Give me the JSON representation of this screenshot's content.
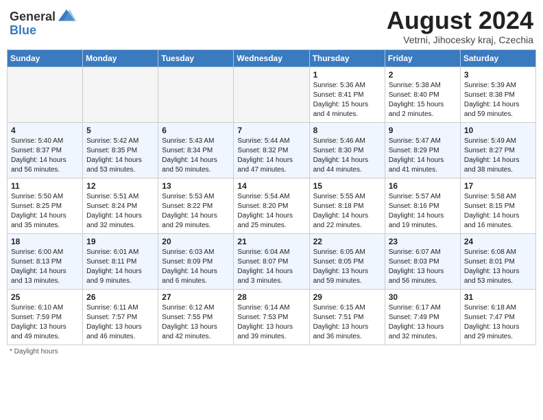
{
  "header": {
    "logo_general": "General",
    "logo_blue": "Blue",
    "month_year": "August 2024",
    "location": "Vetrni, Jihocesky kraj, Czechia"
  },
  "columns": [
    "Sunday",
    "Monday",
    "Tuesday",
    "Wednesday",
    "Thursday",
    "Friday",
    "Saturday"
  ],
  "weeks": [
    {
      "days": [
        {
          "num": "",
          "info": ""
        },
        {
          "num": "",
          "info": ""
        },
        {
          "num": "",
          "info": ""
        },
        {
          "num": "",
          "info": ""
        },
        {
          "num": "1",
          "info": "Sunrise: 5:36 AM\nSunset: 8:41 PM\nDaylight: 15 hours\nand 4 minutes."
        },
        {
          "num": "2",
          "info": "Sunrise: 5:38 AM\nSunset: 8:40 PM\nDaylight: 15 hours\nand 2 minutes."
        },
        {
          "num": "3",
          "info": "Sunrise: 5:39 AM\nSunset: 8:38 PM\nDaylight: 14 hours\nand 59 minutes."
        }
      ]
    },
    {
      "days": [
        {
          "num": "4",
          "info": "Sunrise: 5:40 AM\nSunset: 8:37 PM\nDaylight: 14 hours\nand 56 minutes."
        },
        {
          "num": "5",
          "info": "Sunrise: 5:42 AM\nSunset: 8:35 PM\nDaylight: 14 hours\nand 53 minutes."
        },
        {
          "num": "6",
          "info": "Sunrise: 5:43 AM\nSunset: 8:34 PM\nDaylight: 14 hours\nand 50 minutes."
        },
        {
          "num": "7",
          "info": "Sunrise: 5:44 AM\nSunset: 8:32 PM\nDaylight: 14 hours\nand 47 minutes."
        },
        {
          "num": "8",
          "info": "Sunrise: 5:46 AM\nSunset: 8:30 PM\nDaylight: 14 hours\nand 44 minutes."
        },
        {
          "num": "9",
          "info": "Sunrise: 5:47 AM\nSunset: 8:29 PM\nDaylight: 14 hours\nand 41 minutes."
        },
        {
          "num": "10",
          "info": "Sunrise: 5:49 AM\nSunset: 8:27 PM\nDaylight: 14 hours\nand 38 minutes."
        }
      ]
    },
    {
      "days": [
        {
          "num": "11",
          "info": "Sunrise: 5:50 AM\nSunset: 8:25 PM\nDaylight: 14 hours\nand 35 minutes."
        },
        {
          "num": "12",
          "info": "Sunrise: 5:51 AM\nSunset: 8:24 PM\nDaylight: 14 hours\nand 32 minutes."
        },
        {
          "num": "13",
          "info": "Sunrise: 5:53 AM\nSunset: 8:22 PM\nDaylight: 14 hours\nand 29 minutes."
        },
        {
          "num": "14",
          "info": "Sunrise: 5:54 AM\nSunset: 8:20 PM\nDaylight: 14 hours\nand 25 minutes."
        },
        {
          "num": "15",
          "info": "Sunrise: 5:55 AM\nSunset: 8:18 PM\nDaylight: 14 hours\nand 22 minutes."
        },
        {
          "num": "16",
          "info": "Sunrise: 5:57 AM\nSunset: 8:16 PM\nDaylight: 14 hours\nand 19 minutes."
        },
        {
          "num": "17",
          "info": "Sunrise: 5:58 AM\nSunset: 8:15 PM\nDaylight: 14 hours\nand 16 minutes."
        }
      ]
    },
    {
      "days": [
        {
          "num": "18",
          "info": "Sunrise: 6:00 AM\nSunset: 8:13 PM\nDaylight: 14 hours\nand 13 minutes."
        },
        {
          "num": "19",
          "info": "Sunrise: 6:01 AM\nSunset: 8:11 PM\nDaylight: 14 hours\nand 9 minutes."
        },
        {
          "num": "20",
          "info": "Sunrise: 6:03 AM\nSunset: 8:09 PM\nDaylight: 14 hours\nand 6 minutes."
        },
        {
          "num": "21",
          "info": "Sunrise: 6:04 AM\nSunset: 8:07 PM\nDaylight: 14 hours\nand 3 minutes."
        },
        {
          "num": "22",
          "info": "Sunrise: 6:05 AM\nSunset: 8:05 PM\nDaylight: 13 hours\nand 59 minutes."
        },
        {
          "num": "23",
          "info": "Sunrise: 6:07 AM\nSunset: 8:03 PM\nDaylight: 13 hours\nand 56 minutes."
        },
        {
          "num": "24",
          "info": "Sunrise: 6:08 AM\nSunset: 8:01 PM\nDaylight: 13 hours\nand 53 minutes."
        }
      ]
    },
    {
      "days": [
        {
          "num": "25",
          "info": "Sunrise: 6:10 AM\nSunset: 7:59 PM\nDaylight: 13 hours\nand 49 minutes."
        },
        {
          "num": "26",
          "info": "Sunrise: 6:11 AM\nSunset: 7:57 PM\nDaylight: 13 hours\nand 46 minutes."
        },
        {
          "num": "27",
          "info": "Sunrise: 6:12 AM\nSunset: 7:55 PM\nDaylight: 13 hours\nand 42 minutes."
        },
        {
          "num": "28",
          "info": "Sunrise: 6:14 AM\nSunset: 7:53 PM\nDaylight: 13 hours\nand 39 minutes."
        },
        {
          "num": "29",
          "info": "Sunrise: 6:15 AM\nSunset: 7:51 PM\nDaylight: 13 hours\nand 36 minutes."
        },
        {
          "num": "30",
          "info": "Sunrise: 6:17 AM\nSunset: 7:49 PM\nDaylight: 13 hours\nand 32 minutes."
        },
        {
          "num": "31",
          "info": "Sunrise: 6:18 AM\nSunset: 7:47 PM\nDaylight: 13 hours\nand 29 minutes."
        }
      ]
    }
  ],
  "footer": "* Daylight hours"
}
